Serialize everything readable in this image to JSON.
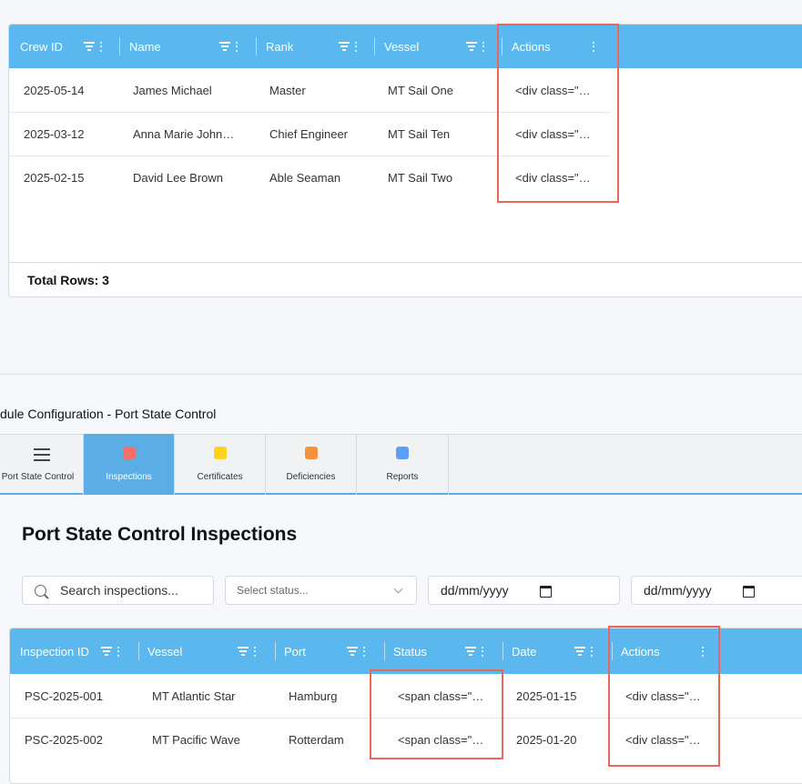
{
  "crew_grid": {
    "columns": [
      "Crew ID",
      "Name",
      "Rank",
      "Vessel",
      "Actions"
    ],
    "rows": [
      [
        "2025-05-14",
        "James Michael",
        "Master",
        "MT Sail One",
        "<div class=\"…"
      ],
      [
        "2025-03-12",
        "Anna Marie John…",
        "Chief Engineer",
        "MT Sail Ten",
        "<div class=\"…"
      ],
      [
        "2025-02-15",
        "David Lee Brown",
        "Able Seaman",
        "MT Sail Two",
        "<div class=\"…"
      ]
    ],
    "footer": "Total Rows: 3"
  },
  "module_title": "dule Configuration - Port State Control",
  "tabs": [
    {
      "label": "Port State Control",
      "icon": "hamburger-menu-icon"
    },
    {
      "label": "Inspections",
      "color": "#f0716b",
      "active": true
    },
    {
      "label": "Certificates",
      "color": "#ffd21f"
    },
    {
      "label": "Deficiencies",
      "color": "#f6923d"
    },
    {
      "label": "Reports",
      "color": "#5d9ef5"
    }
  ],
  "page_title": "Port State Control Inspections",
  "search": {
    "placeholder": "Search inspections..."
  },
  "status_select": {
    "placeholder": "Select status..."
  },
  "date_from": {
    "placeholder": "dd/mm/yyyy"
  },
  "date_to": {
    "placeholder": "dd/mm/yyyy"
  },
  "inspection_grid": {
    "columns": [
      "Inspection ID",
      "Vessel",
      "Port",
      "Status",
      "Date",
      "Actions"
    ],
    "rows": [
      [
        "PSC-2025-001",
        "MT Atlantic Star",
        "Hamburg",
        "<span class=\"…",
        "2025-01-15",
        "<div class=\"…"
      ],
      [
        "PSC-2025-002",
        "MT Pacific Wave",
        "Rotterdam",
        "<span class=\"…",
        "2025-01-20",
        "<div class=\"…"
      ]
    ]
  },
  "colors": {
    "header": "#5bb8ee",
    "highlight": "#e8675d",
    "active_tab": "#5aaee5"
  }
}
